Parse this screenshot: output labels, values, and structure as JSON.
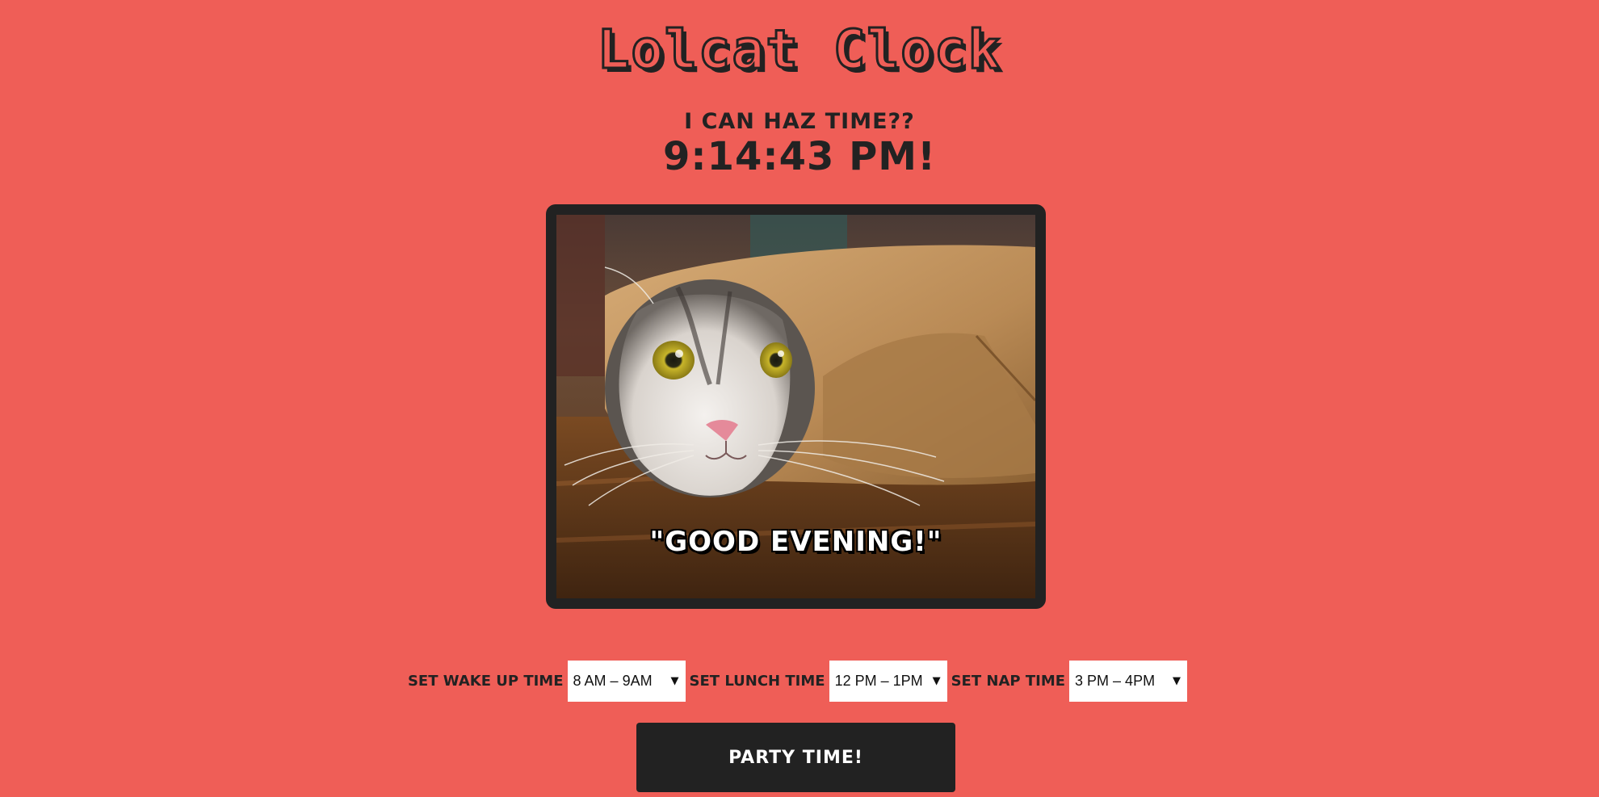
{
  "page": {
    "title": "Lolcat Clock",
    "background_color": "#ef5e57",
    "accent_color": "#222222"
  },
  "clock": {
    "subtitle": "I can haz time??",
    "time": "9:14:43 PM!"
  },
  "photo": {
    "subject": "cat peeking out of rolled brown paper",
    "caption": "\"GOOD EVENING!\""
  },
  "controls": {
    "wake_up": {
      "label": "Set Wake Up Time",
      "selected": "8 AM – 9AM"
    },
    "lunch": {
      "label": "Set Lunch Time",
      "selected": "12 PM – 1PM"
    },
    "nap": {
      "label": "Set Nap Time",
      "selected": "3 PM – 4PM"
    },
    "dropdown_icon": "triangle-down-icon"
  },
  "party_button": {
    "label": "Party Time!"
  }
}
